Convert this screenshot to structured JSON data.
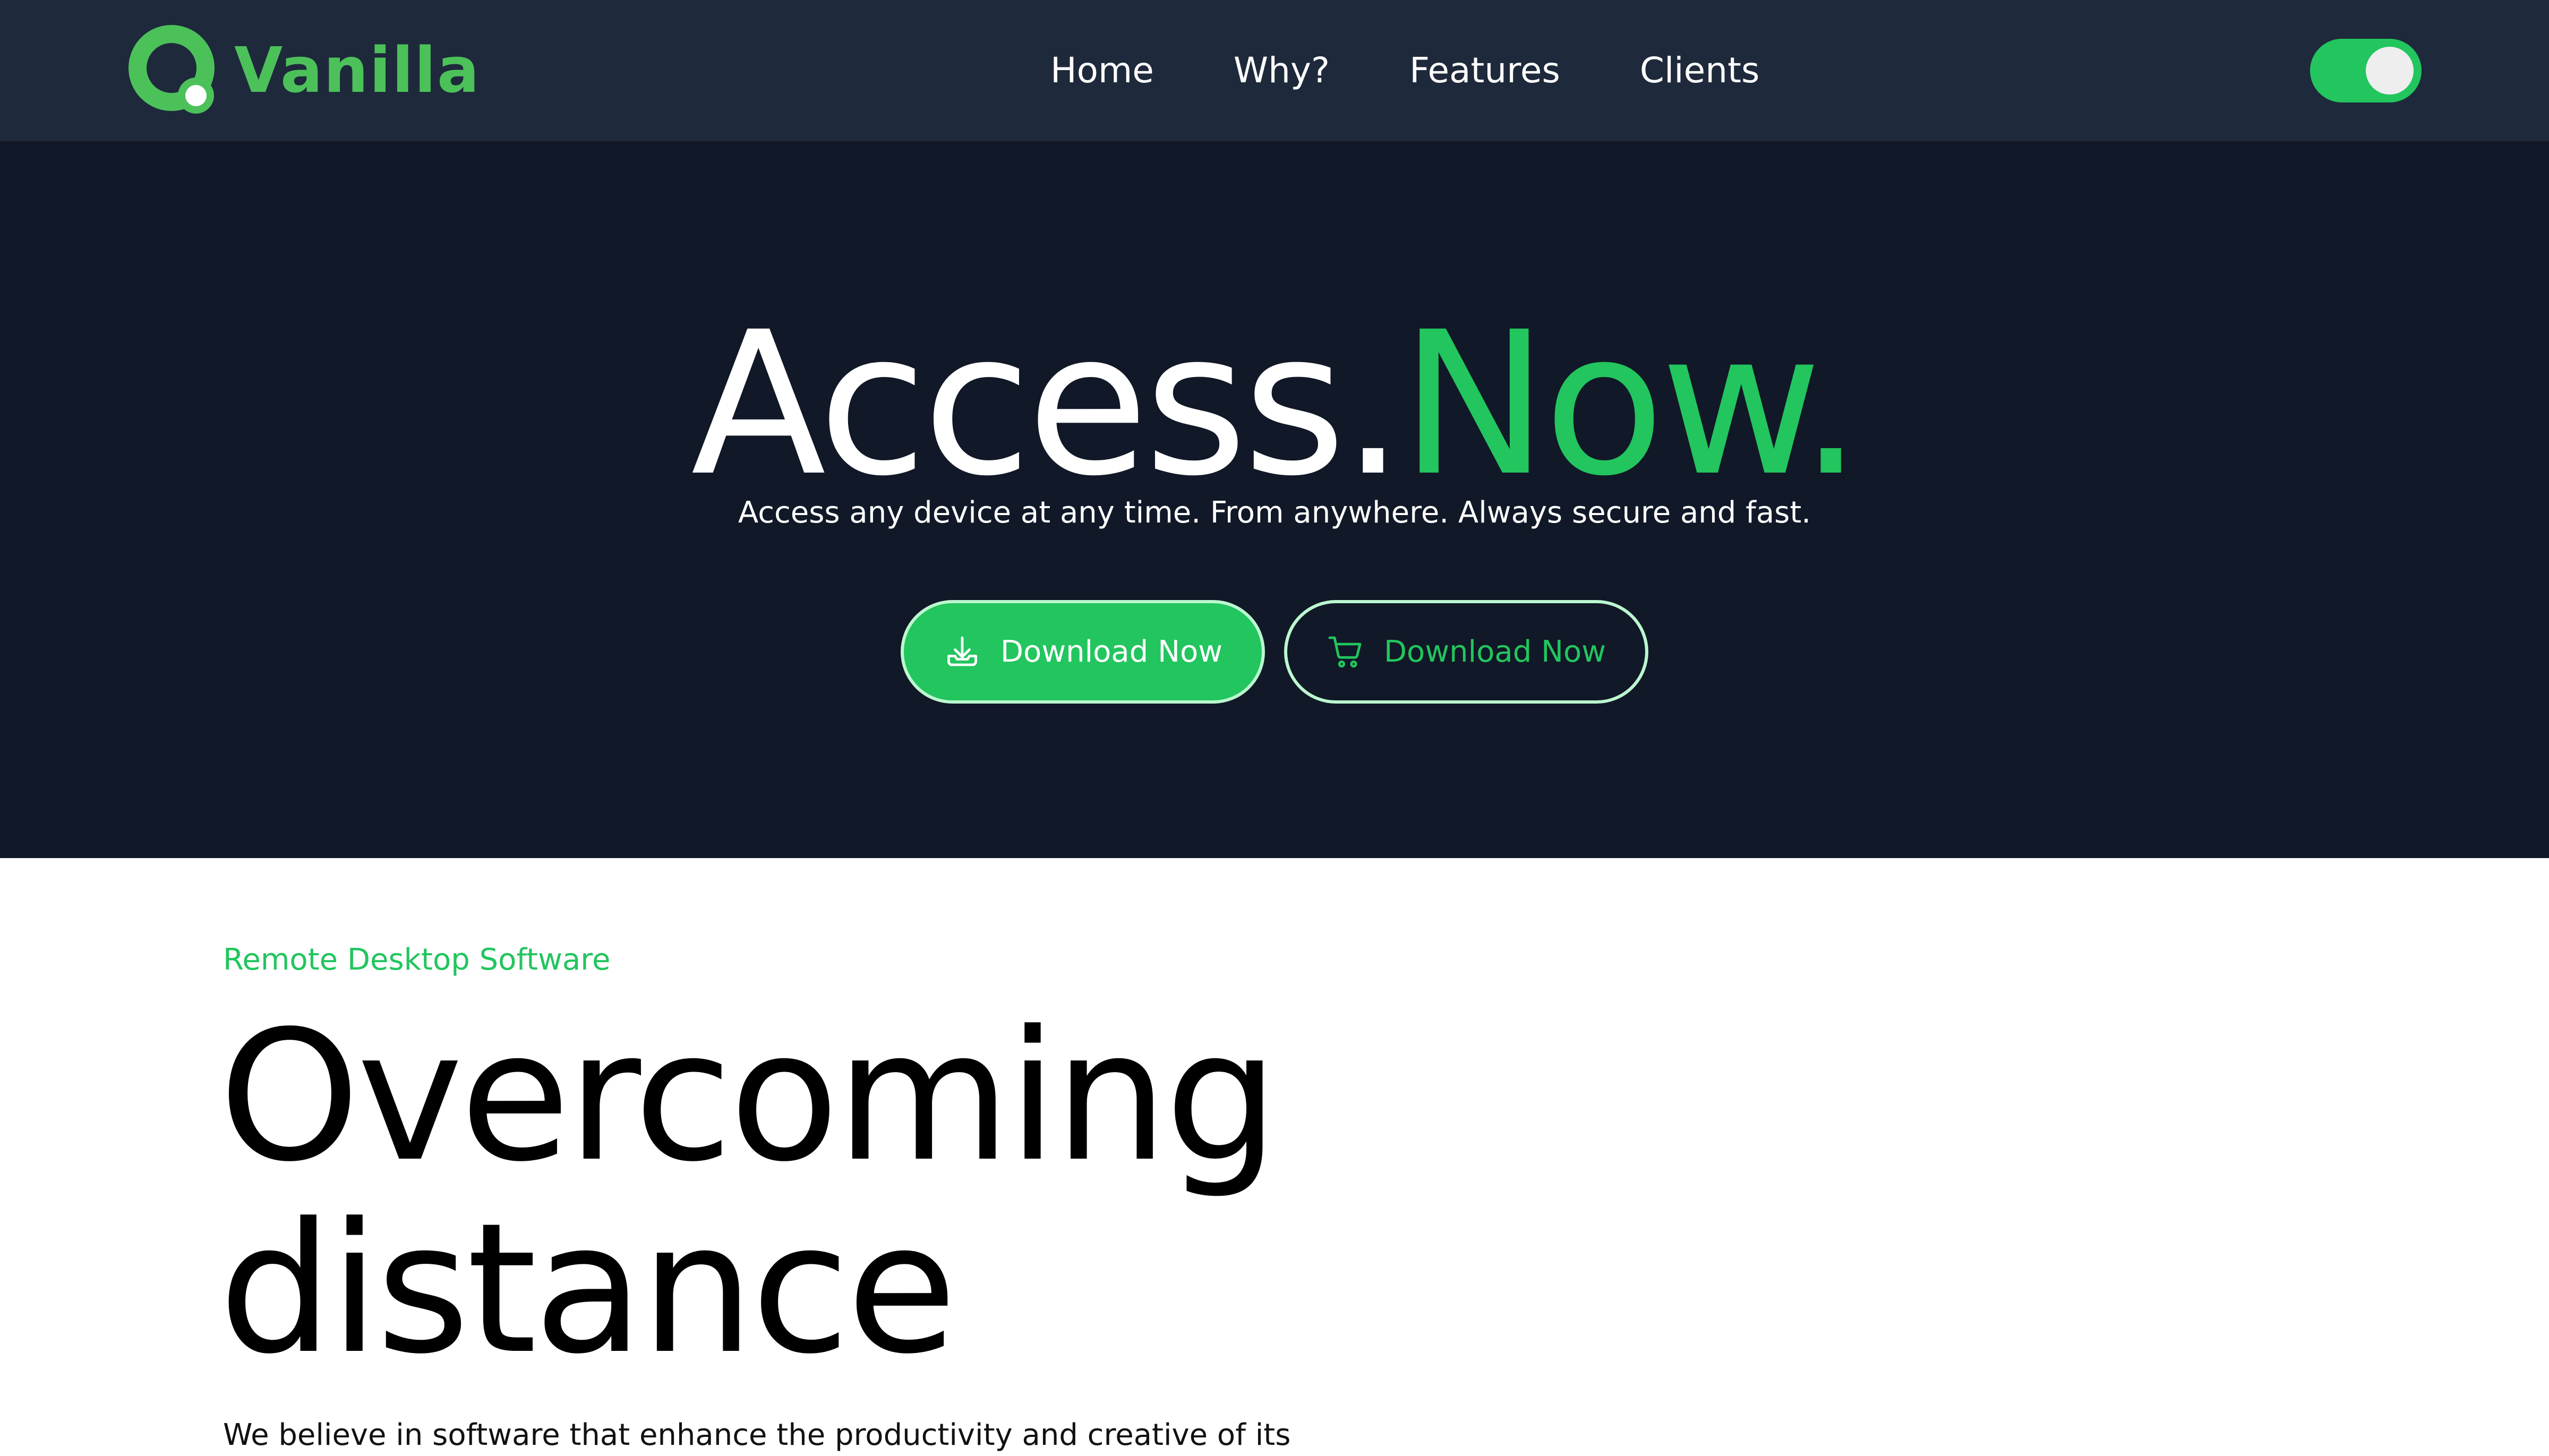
{
  "navbar": {
    "brand": {
      "name": "Vanilla",
      "logo_icon": "vanilla-q-logo-icon"
    },
    "links": [
      {
        "label": "Home"
      },
      {
        "label": "Why?"
      },
      {
        "label": "Features"
      },
      {
        "label": "Clients"
      }
    ],
    "theme_toggle": {
      "state": "on",
      "icon": "toggle-switch"
    }
  },
  "hero": {
    "title_part_1": "Access.",
    "title_part_2": "Now.",
    "subtitle": "Access any device at any time. From anywhere. Always secure and fast.",
    "primary_button": {
      "label": "Download Now",
      "icon": "download-icon"
    },
    "secondary_button": {
      "label": "Download Now",
      "icon": "cart-icon"
    }
  },
  "section": {
    "eyebrow": "Remote Desktop Software",
    "title_line_1": "Overcoming",
    "title_line_2": "distance",
    "body": "We believe in software that enhance the productivity and creative of its"
  },
  "colors": {
    "navbar_bg": "#1e293b",
    "hero_bg": "#111827",
    "accent_green": "#22c55e",
    "logo_green": "#4cc15a",
    "button_border": "#bbf7d0",
    "text_white": "#ffffff",
    "text_black": "#000000"
  }
}
